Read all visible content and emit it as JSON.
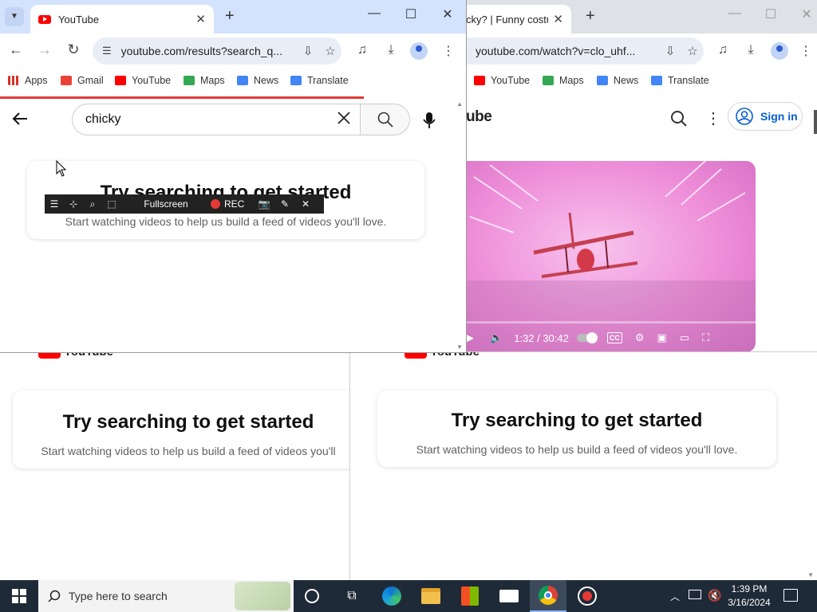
{
  "colors": {
    "brand_red": "#ff0000",
    "accent_blue": "#065fd4",
    "progress_red": "#e53935",
    "taskbar": "#1f2a38"
  },
  "bookmarks": [
    "Apps",
    "Gmail",
    "YouTube",
    "Maps",
    "News",
    "Translate"
  ],
  "left_window": {
    "tab_title": "YouTube",
    "url": "youtube.com/results?search_q...",
    "search_value": "chicky",
    "card_title": "Try searching to get started",
    "card_subtitle": "Start watching videos to help us build a feed of videos you'll love.",
    "page_load_progress": 0.78
  },
  "recorder_bar": {
    "fullscreen_label": "Fullscreen",
    "rec_label": "REC"
  },
  "right_window": {
    "tab_title": "cky? | Funny costur",
    "url": "youtube.com/watch?v=clo_uhf...",
    "logo_fragment": "ube",
    "sign_in_label": "Sign in",
    "video_time": "1:32 / 30:42"
  },
  "background_windows": {
    "logo_text": "YouTube",
    "left_card_title": "Try searching to get started",
    "left_card_subtitle": "Start watching videos to help us build a feed of videos you'll",
    "right_card_title": "Try searching to get started",
    "right_card_subtitle": "Start watching videos to help us build a feed of videos you'll love."
  },
  "taskbar": {
    "search_placeholder": "Type here to search",
    "time": "1:39 PM",
    "date": "3/16/2024",
    "apps": [
      "task-view",
      "edge",
      "file-explorer",
      "microsoft-store",
      "mail",
      "chrome",
      "screen-recorder"
    ]
  }
}
